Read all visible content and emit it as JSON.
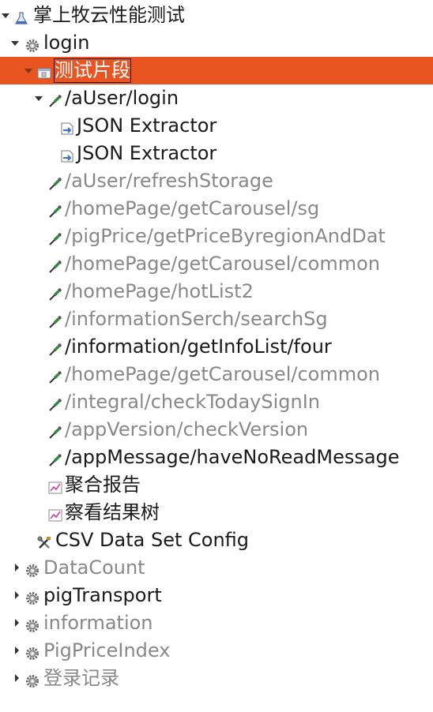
{
  "tree": {
    "root_label": "掌上牧云性能测试",
    "login_label": "login",
    "fragment_label": "测试片段",
    "auser_login_label": "/aUser/login",
    "json_extractor_1": "JSON Extractor",
    "json_extractor_2": "JSON Extractor",
    "samplers": [
      "/aUser/refreshStorage",
      "/homePage/getCarousel/sg",
      "/pigPrice/getPriceByregionAndDat",
      "/homePage/getCarousel/common",
      "/homePage/hotList2",
      "/informationSerch/searchSg",
      "/information/getInfoList/four",
      "/homePage/getCarousel/common",
      "/integral/checkTodaySignIn",
      "/appVersion/checkVersion",
      "/appMessage/haveNoReadMessage"
    ],
    "listeners": [
      "聚合报告",
      "察看结果树"
    ],
    "csv_label": "CSV Data Set Config",
    "thread_groups": [
      "DataCount",
      "pigTransport",
      "information",
      "PigPriceIndex",
      "登录记录"
    ]
  },
  "colors": {
    "selection": "#e95420",
    "disabled_text": "#888888",
    "text": "#1a1a1a"
  }
}
